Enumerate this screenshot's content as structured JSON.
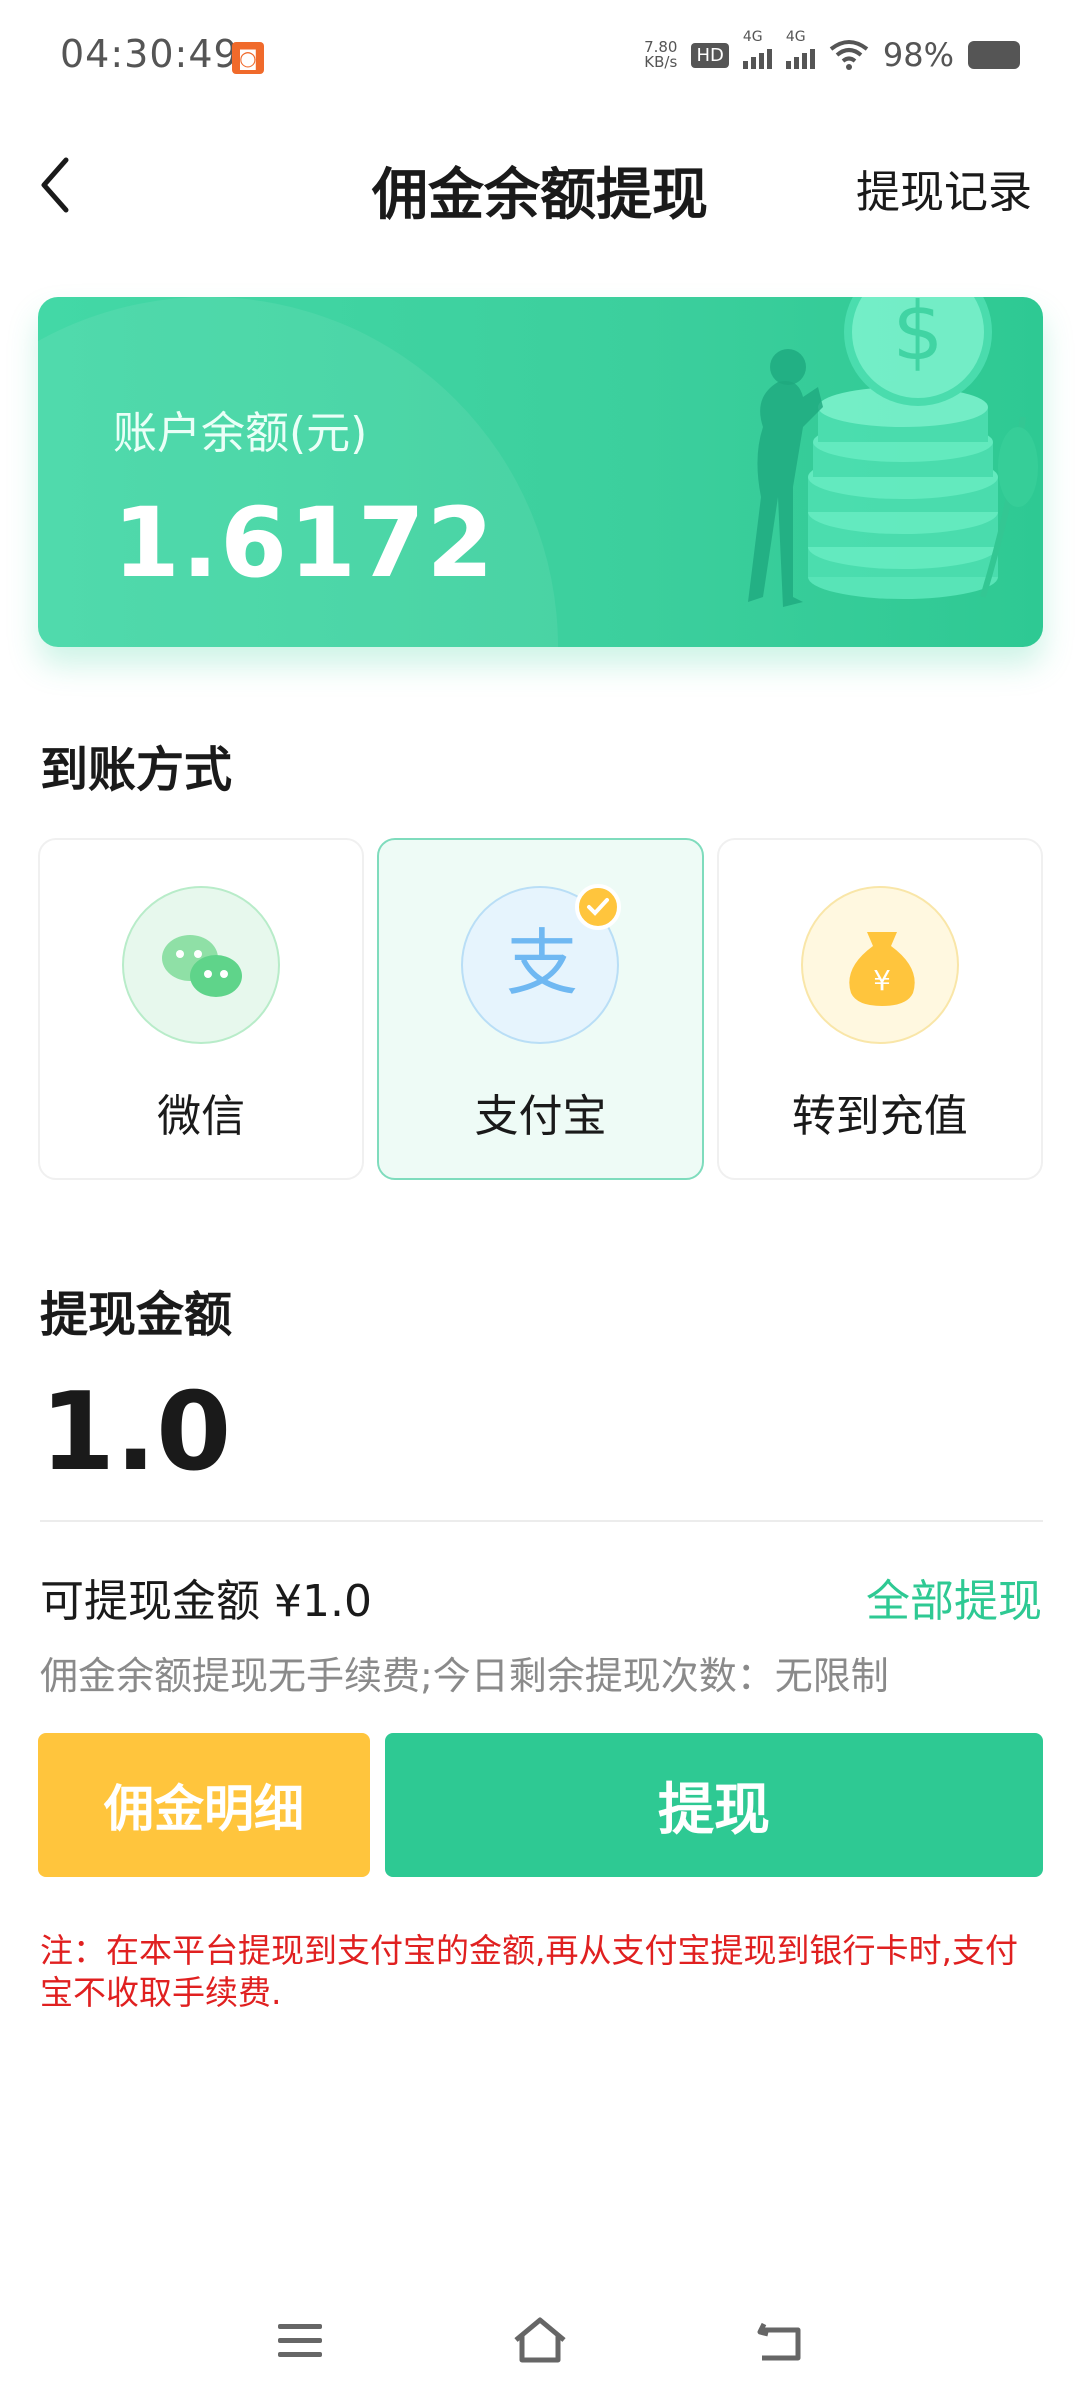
{
  "status_bar": {
    "time": "04:30:49",
    "net_speed_value": "7.80",
    "net_speed_unit": "KB/s",
    "hd_label": "HD",
    "signal1_label": "4G",
    "signal2_label": "4G",
    "battery_percent": "98%"
  },
  "header": {
    "title": "佣金余额提现",
    "record_link": "提现记录"
  },
  "balance_card": {
    "label": "账户余额(元)",
    "value": "1.6172"
  },
  "payment": {
    "section_title": "到账方式",
    "selected": "支付宝",
    "methods": [
      {
        "label": "微信",
        "icon": "wechat-icon",
        "color": "#3ecf7a"
      },
      {
        "label": "支付宝",
        "icon": "alipay-icon",
        "color": "#1e9bff"
      },
      {
        "label": "转到充值",
        "icon": "money-bag-icon",
        "color": "#ffc53d"
      }
    ]
  },
  "amount": {
    "section_title": "提现金额",
    "value": "1.0",
    "available_label": "可提现金额 ¥1.0",
    "withdraw_all": "全部提现",
    "fee_note": "佣金余额提现无手续费;今日剩余提现次数：无限制"
  },
  "buttons": {
    "detail": "佣金明细",
    "withdraw": "提现"
  },
  "notice": "注：在本平台提现到支付宝的金额,再从支付宝提现到银行卡时,支付宝不收取手续费.",
  "colors": {
    "primary": "#2ec993",
    "accent_yellow": "#ffc53d",
    "notice_red": "#e02020"
  }
}
